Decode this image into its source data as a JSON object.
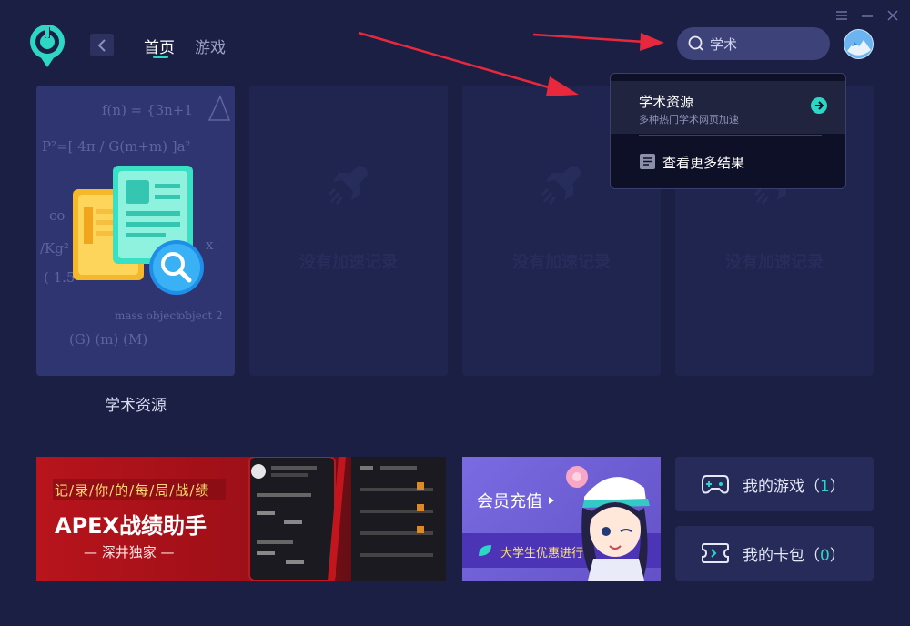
{
  "nav": {
    "tabs": [
      {
        "label": "首页"
      },
      {
        "label": "游戏"
      }
    ]
  },
  "search": {
    "value": "学术"
  },
  "window": {
    "controls": [
      "menu-icon",
      "minimize-icon",
      "close-icon"
    ]
  },
  "cards": {
    "main_label": "学术资源",
    "empty_text": "没有加速记录"
  },
  "dropdown": {
    "item_title": "学术资源",
    "item_subtitle": "多种热门学术网页加速",
    "more_label": "查看更多结果"
  },
  "banner_apex": {
    "tag": "记/录/你/的/每/局/战/绩",
    "title": "APEX战绩助手",
    "subtitle": "— 深井独家 —"
  },
  "banner_vip": {
    "title": "会员充值",
    "strip": "大学生优惠进行中"
  },
  "side": {
    "games_label": "我的游戏（",
    "games_count": "1",
    "games_close": "）",
    "wallet_label": "我的卡包（",
    "wallet_count": "0",
    "wallet_close": "）"
  },
  "colors": {
    "accent": "#2ed6c5",
    "background": "#1b1f44",
    "arrow": "#e8283c"
  }
}
